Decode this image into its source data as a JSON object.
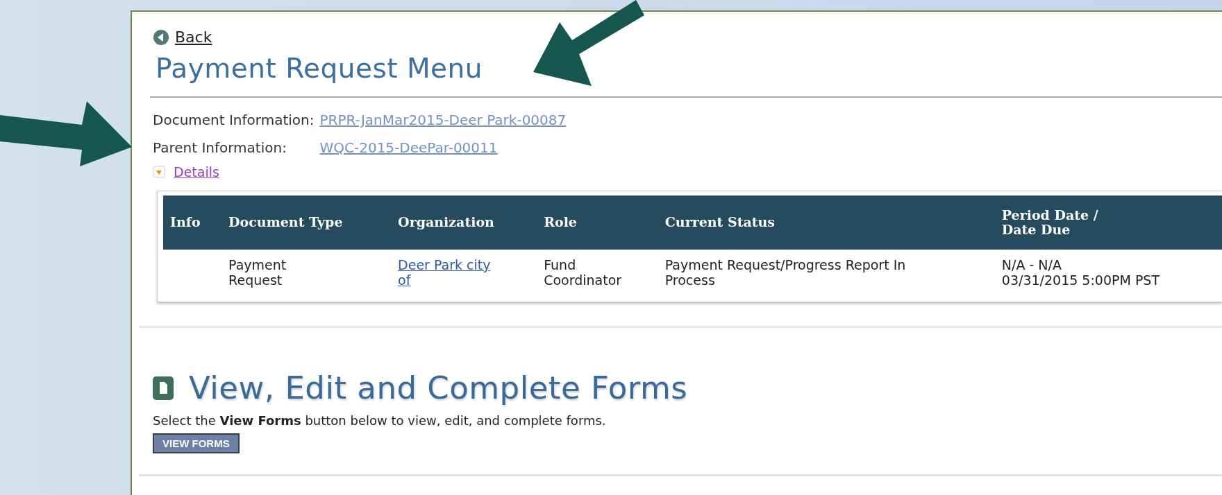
{
  "back_link": "Back",
  "title": "Payment Request Menu",
  "document_info": [
    {
      "label": "Document Information:",
      "link": "PRPR-JanMar2015-Deer Park-00087"
    },
    {
      "label": "Parent Information:",
      "link": "WQC-2015-DeePar-00011"
    }
  ],
  "details": {
    "label": "Details",
    "expanded": false
  },
  "table": {
    "columns": [
      "Info",
      "Document Type",
      "Organization",
      "Role",
      "Current Status",
      "Period Date /\nDate Due"
    ],
    "rows": [
      {
        "cells": [
          "",
          "Payment\nRequest",
          "Deer Park city\nof",
          "Fund\nCoordinator",
          "Payment Request/Progress Report In\nProcess",
          "N/A - N/A\n03/31/2015 5:00PM PST"
        ]
      }
    ]
  },
  "forms_section": {
    "heading": "View, Edit and Complete Forms",
    "instruction": "Select the **View Forms** button below to view, edit, and complete forms.",
    "button": "VIEW FORMS"
  }
}
